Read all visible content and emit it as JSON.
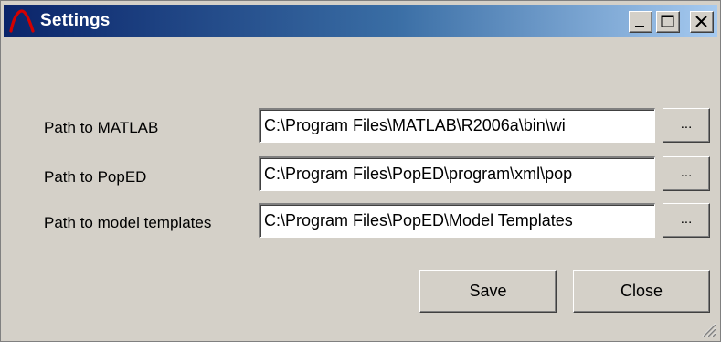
{
  "window": {
    "title": "Settings"
  },
  "titlebar_buttons": {
    "minimize_icon": "minimize-icon",
    "maximize_icon": "maximize-icon",
    "close_icon": "close-icon"
  },
  "fields": [
    {
      "label": "Path to MATLAB",
      "value": "C:\\Program Files\\MATLAB\\R2006a\\bin\\wi",
      "browse_label": "..."
    },
    {
      "label": "Path to PopED",
      "value": "C:\\Program Files\\PopED\\program\\xml\\pop",
      "browse_label": "..."
    },
    {
      "label": "Path to model templates",
      "value": "C:\\Program Files\\PopED\\Model Templates",
      "browse_label": "..."
    }
  ],
  "actions": {
    "save_label": "Save",
    "close_label": "Close"
  },
  "colors": {
    "titlebar_start": "#0a246a",
    "titlebar_end": "#a6caf0",
    "window_bg": "#d4d0c8",
    "app_icon": "#d40000"
  }
}
